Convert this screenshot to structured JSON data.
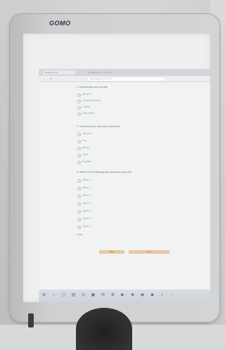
{
  "brand": "GOMO",
  "browser": {
    "tab_label": "Google Forms",
    "tab_strip_text": "Google Forms — Survey",
    "nav_buttons": "←  →  ↻",
    "address": "docs.google.com/forms"
  },
  "form": {
    "questions": [
      {
        "title": "1. How familiar are you with",
        "options": [
          "Not at all",
          "Somewhat familiar",
          "Familiar",
          "Very familiar"
        ]
      },
      {
        "title": "2. How would you rate your experience",
        "options": [
          "Very poor",
          "Poor",
          "Neutral",
          "Good",
          "Excellent"
        ]
      },
      {
        "title": "3. Which of the following best describes your role",
        "options": [
          "Option 1",
          "Option 2",
          "Option 3",
          "Option 4",
          "Option 5",
          "Option 6",
          "Option 7"
        ]
      }
    ],
    "answer_label": "Other:",
    "buttons": [
      "Back",
      "Next"
    ]
  },
  "taskbar": {
    "icons": [
      "start-icon",
      "search-icon",
      "task-view-icon",
      "explorer-icon",
      "browser-icon",
      "store-icon",
      "mail-icon",
      "settings-icon",
      "media-icon",
      "word-icon",
      "chrome-icon",
      "app-icon",
      "app2-icon",
      "app3-icon"
    ]
  }
}
